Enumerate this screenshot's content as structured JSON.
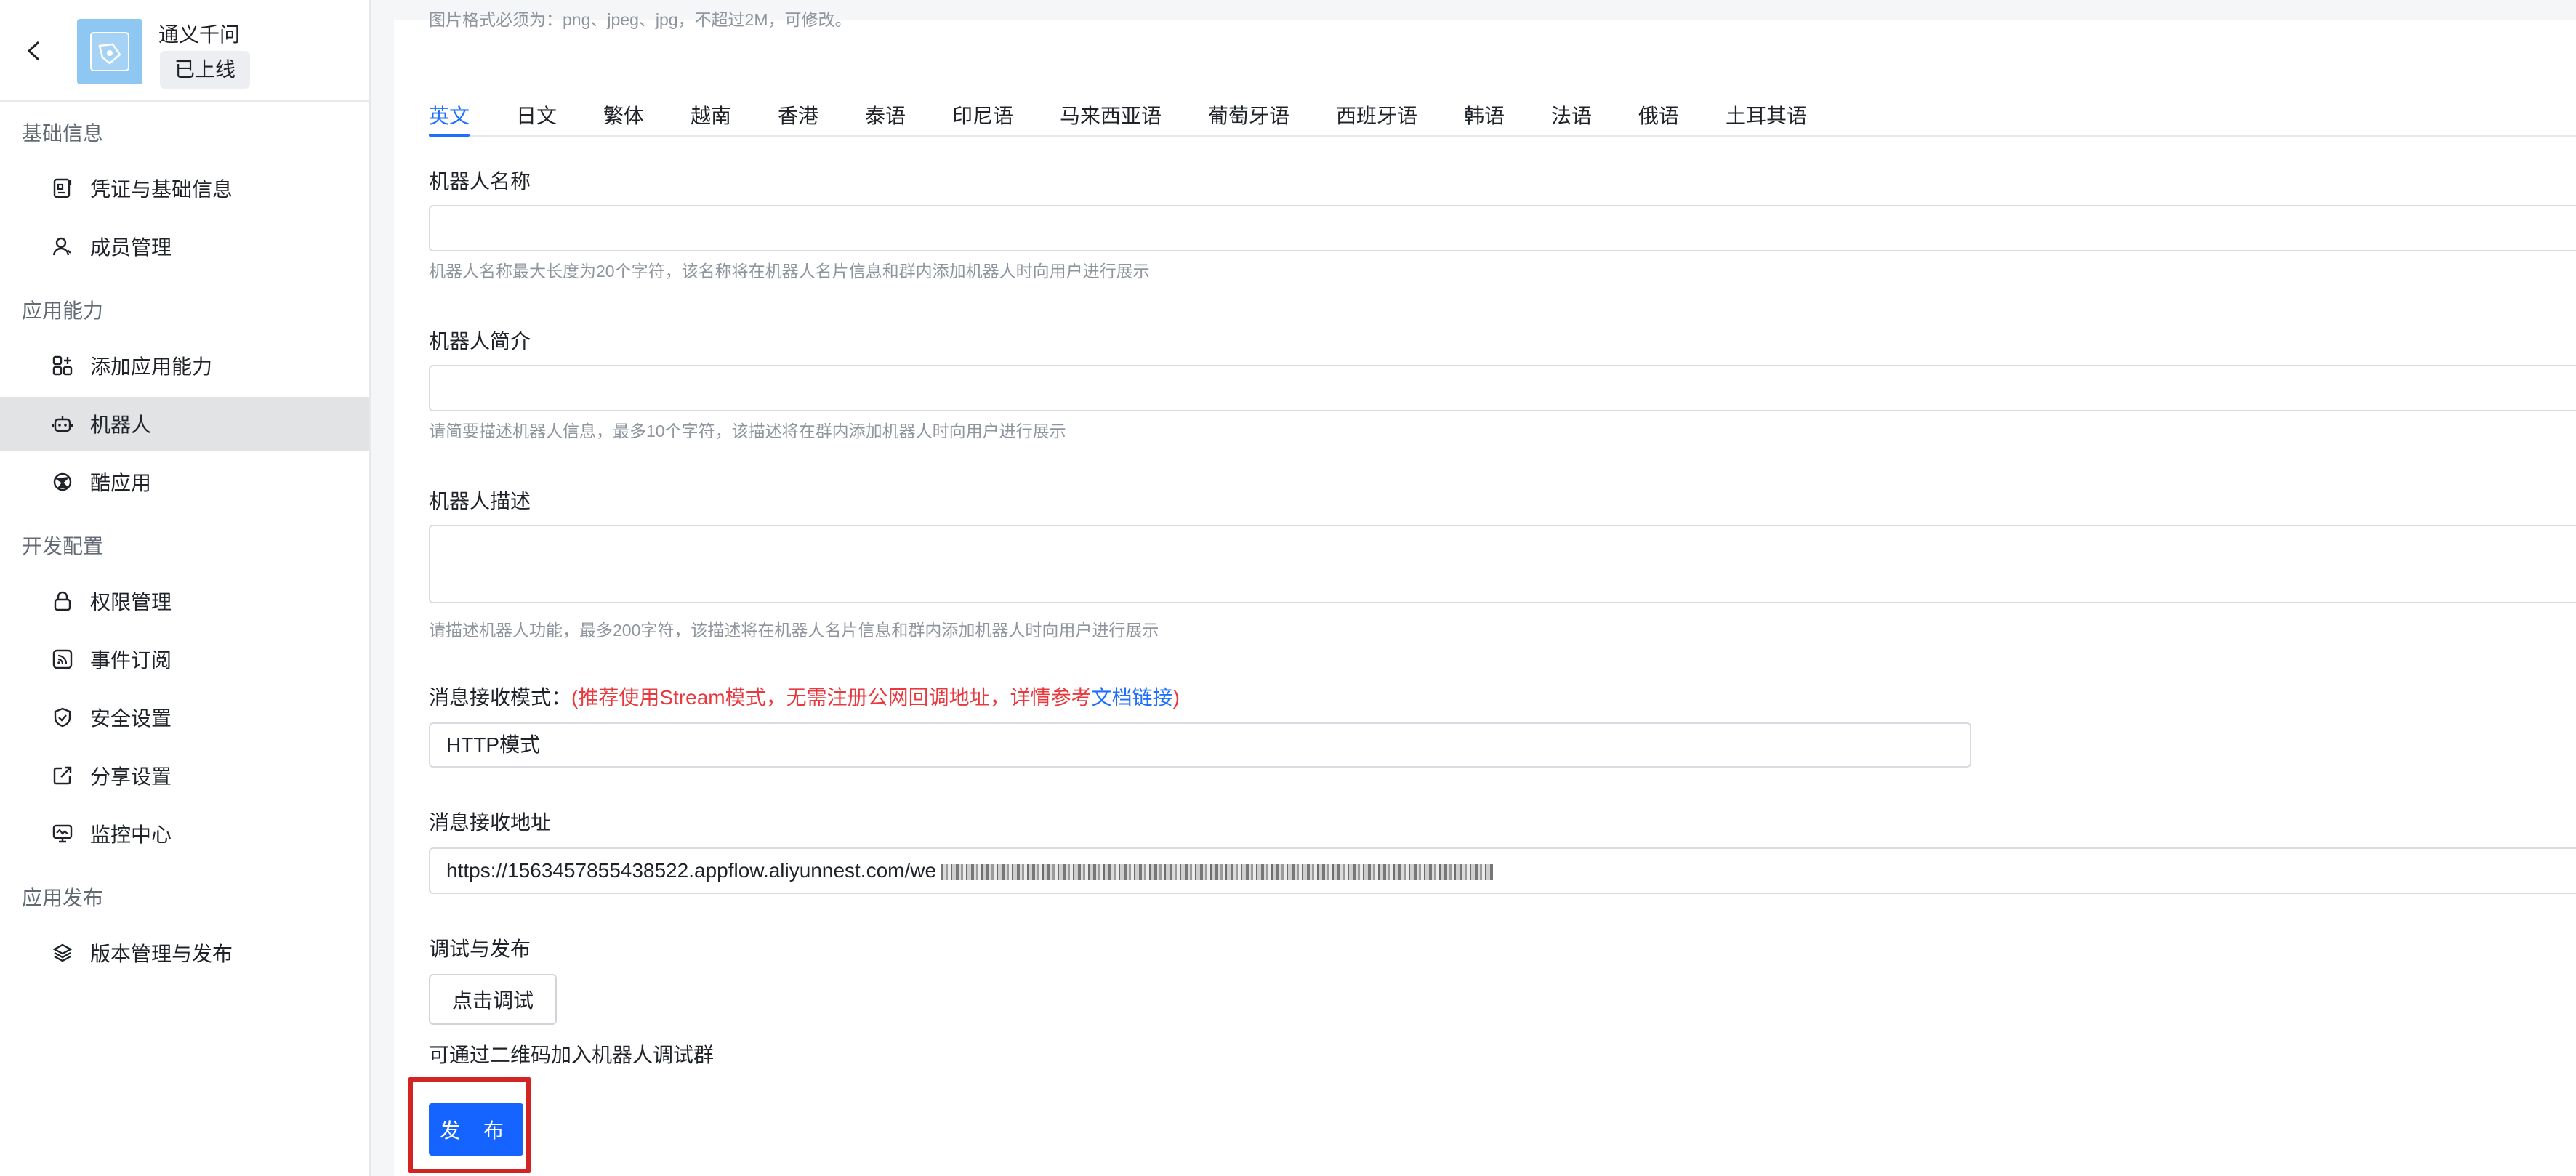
{
  "sidebar": {
    "app_name": "通义千问",
    "app_status": "已上线",
    "sections": [
      {
        "title": "基础信息",
        "items": [
          {
            "label": "凭证与基础信息",
            "icon": "credential-icon"
          },
          {
            "label": "成员管理",
            "icon": "user-icon"
          }
        ]
      },
      {
        "title": "应用能力",
        "items": [
          {
            "label": "添加应用能力",
            "icon": "apps-add-icon"
          },
          {
            "label": "机器人",
            "icon": "robot-icon",
            "active": true
          },
          {
            "label": "酷应用",
            "icon": "cool-app-icon"
          }
        ]
      },
      {
        "title": "开发配置",
        "items": [
          {
            "label": "权限管理",
            "icon": "lock-icon"
          },
          {
            "label": "事件订阅",
            "icon": "rss-icon"
          },
          {
            "label": "安全设置",
            "icon": "shield-icon"
          },
          {
            "label": "分享设置",
            "icon": "share-icon"
          },
          {
            "label": "监控中心",
            "icon": "monitor-icon"
          }
        ]
      },
      {
        "title": "应用发布",
        "items": [
          {
            "label": "版本管理与发布",
            "icon": "layers-icon"
          }
        ]
      }
    ]
  },
  "main": {
    "cut_hint": "图片格式必须为：png、jpeg、jpg，不超过2M，可修改。",
    "tabs": [
      "英文",
      "日文",
      "繁体",
      "越南",
      "香港",
      "泰语",
      "印尼语",
      "马来西亚语",
      "葡萄牙语",
      "西班牙语",
      "韩语",
      "法语",
      "俄语",
      "土耳其语"
    ],
    "active_tab": "英文",
    "robot_name": {
      "label": "机器人名称",
      "value": "",
      "hint": "机器人名称最大长度为20个字符，该名称将在机器人名片信息和群内添加机器人时向用户进行展示"
    },
    "robot_intro": {
      "label": "机器人简介",
      "value": "",
      "hint": "请简要描述机器人信息，最多10个字符，该描述将在群内添加机器人时向用户进行展示"
    },
    "robot_desc": {
      "label": "机器人描述",
      "value": "",
      "hint": "请描述机器人功能，最多200字符，该描述将在机器人名片信息和群内添加机器人时向用户进行展示"
    },
    "msg_mode": {
      "label": "消息接收模式：",
      "paren_open": "(",
      "note": "推荐使用Stream模式，无需注册公网回调地址，详情参考",
      "link": "文档链接",
      "paren_close": ")",
      "value": "HTTP模式"
    },
    "msg_url": {
      "label": "消息接收地址",
      "value": "https://1563457855438522.appflow.aliyunnest.com/we"
    },
    "debug": {
      "label": "调试与发布",
      "button": "点击调试",
      "qr_text": "可通过二维码加入机器人调试群"
    },
    "publish_button": "发 布"
  },
  "colors": {
    "accent": "#1e6fff",
    "primary_button": "#1664ff",
    "warning_text": "#e8393e",
    "highlight_box": "#d42323",
    "active_nav_bg": "#e2e3e5"
  }
}
